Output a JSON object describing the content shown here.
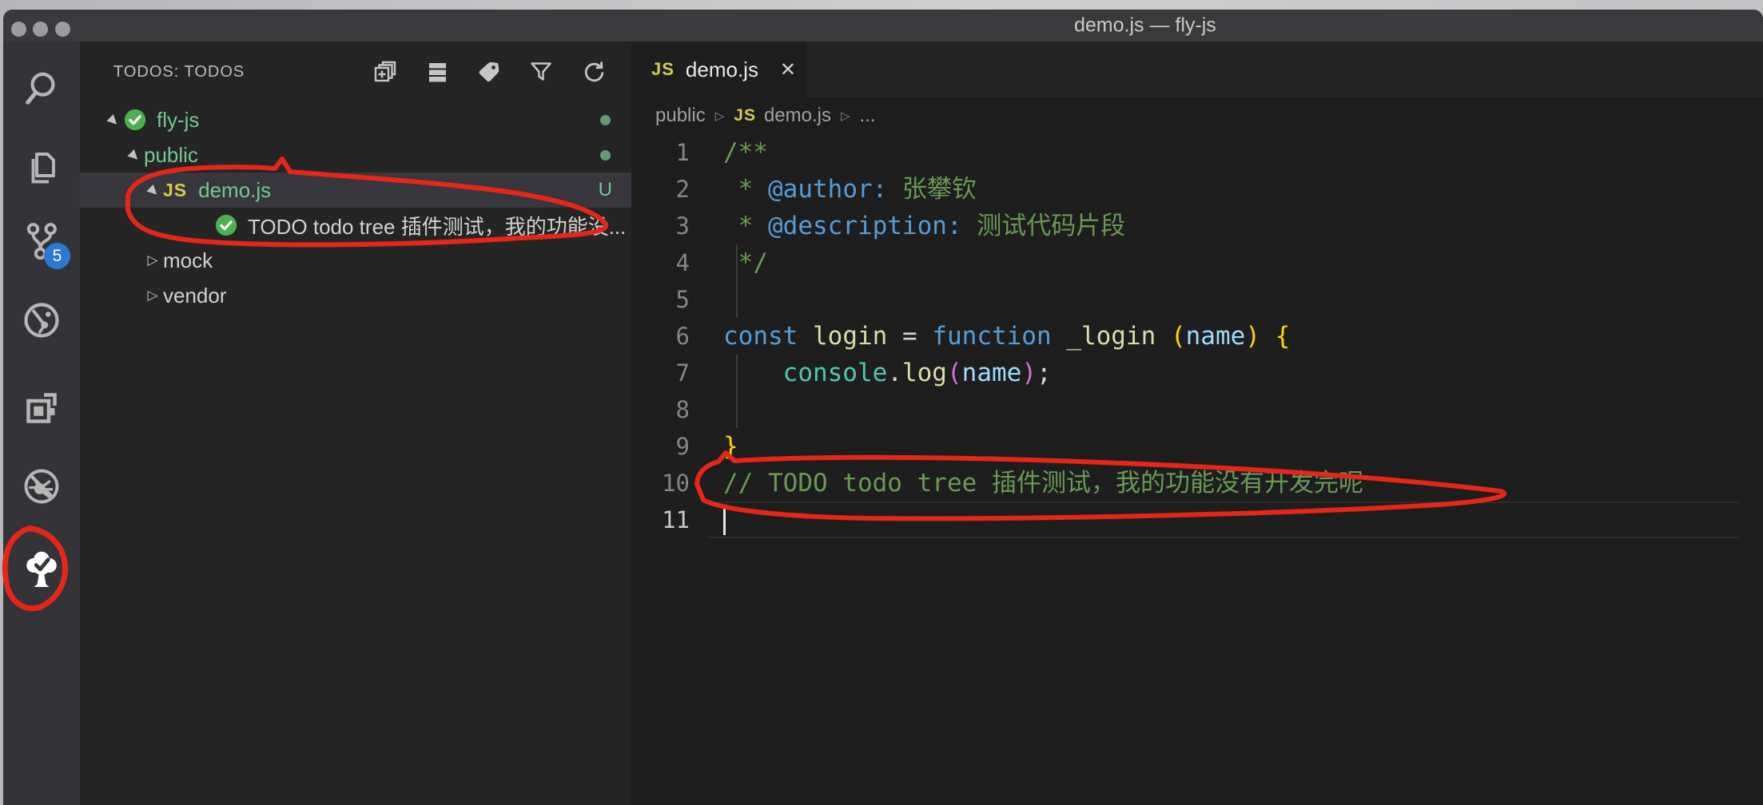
{
  "window": {
    "title": "demo.js — fly-js"
  },
  "titlebar": {
    "traffic_lights": [
      "close",
      "minimize",
      "zoom"
    ]
  },
  "activity_bar": {
    "badge_color": "#2a7ad2",
    "items": [
      {
        "name": "search"
      },
      {
        "name": "explorer"
      },
      {
        "name": "source-control",
        "badge": "5"
      },
      {
        "name": "debug"
      },
      {
        "name": "extensions"
      },
      {
        "name": "bug-disabled"
      },
      {
        "name": "todo-tree",
        "active": true
      }
    ]
  },
  "sidebar": {
    "title": "TODOS: TODOS",
    "actions": [
      "expand-all",
      "flat-view",
      "tags",
      "filter",
      "refresh"
    ],
    "tree": [
      {
        "label": "fly-js",
        "icon": "check-circle",
        "twistie": "expanded",
        "indent": 0,
        "color": "green",
        "dot": true
      },
      {
        "label": "public",
        "twistie": "expanded",
        "indent": 1,
        "color": "green",
        "dot": true
      },
      {
        "label": "demo.js",
        "icon": "js",
        "twistie": "expanded",
        "indent": 2,
        "color": "green",
        "selected": true,
        "badge": "U"
      },
      {
        "label": "TODO todo tree 插件测试，我的功能没...",
        "icon": "check-circle",
        "indent": 3,
        "color": "white"
      },
      {
        "label": "mock",
        "twistie": "collapsed",
        "indent": 2,
        "color": "white"
      },
      {
        "label": "vendor",
        "twistie": "collapsed",
        "indent": 2,
        "color": "white"
      }
    ]
  },
  "editor": {
    "tabs": [
      {
        "label": "demo.js",
        "icon": "js",
        "close": "✕",
        "active": true
      }
    ],
    "breadcrumb": [
      {
        "label": "public"
      },
      {
        "label": "demo.js",
        "icon": "js"
      },
      {
        "label": "..."
      }
    ],
    "palette": {
      "comment": "#6A9955",
      "keyword": "#569CD6",
      "func": "#DCDCAA",
      "var": "#9CDCFE",
      "cls": "#4EC9B0",
      "punct": "#D4D4D4",
      "b1": "#FFD700",
      "b2": "#DA70D6"
    },
    "code": [
      {
        "n": 1,
        "t": [
          [
            "/**",
            "comment"
          ]
        ]
      },
      {
        "n": 2,
        "t": [
          [
            " * ",
            "comment"
          ],
          [
            "@author:",
            "keyword"
          ],
          [
            " 张攀钦",
            "comment"
          ]
        ]
      },
      {
        "n": 3,
        "t": [
          [
            " * ",
            "comment"
          ],
          [
            "@description:",
            "keyword"
          ],
          [
            " 测试代码片段",
            "comment"
          ]
        ]
      },
      {
        "n": 4,
        "t": [
          [
            " */",
            "comment"
          ]
        ],
        "guide": true
      },
      {
        "n": 5,
        "t": [],
        "guide": true
      },
      {
        "n": 6,
        "t": [
          [
            "const",
            "keyword"
          ],
          [
            " ",
            "punct"
          ],
          [
            "login",
            "func"
          ],
          [
            " = ",
            "punct"
          ],
          [
            "function",
            "keyword"
          ],
          [
            " ",
            "punct"
          ],
          [
            "_login",
            "func"
          ],
          [
            " ",
            "punct"
          ],
          [
            "(",
            "b1"
          ],
          [
            "name",
            "var"
          ],
          [
            ")",
            "b1"
          ],
          [
            " ",
            "punct"
          ],
          [
            "{",
            "b1"
          ]
        ]
      },
      {
        "n": 7,
        "t": [
          [
            "    ",
            "punct"
          ],
          [
            "console",
            "cls"
          ],
          [
            ".",
            "punct"
          ],
          [
            "log",
            "func"
          ],
          [
            "(",
            "b2"
          ],
          [
            "name",
            "var"
          ],
          [
            ")",
            "b2"
          ],
          [
            ";",
            "punct"
          ]
        ],
        "guide": true
      },
      {
        "n": 8,
        "t": [],
        "guide": true
      },
      {
        "n": 9,
        "t": [
          [
            "}",
            "b1"
          ]
        ]
      },
      {
        "n": 10,
        "t": [
          [
            "// TODO todo tree 插件测试，我的功能没有开发完呢",
            "comment"
          ]
        ]
      },
      {
        "n": 11,
        "t": [],
        "cursor": true,
        "current": true
      }
    ]
  },
  "annotations": {
    "color": "#E5261A",
    "items": [
      "circle-around-demo-js-and-todo-rows",
      "circle-around-todo-tree-activity-icon",
      "circle-around-line-10-comment"
    ]
  }
}
